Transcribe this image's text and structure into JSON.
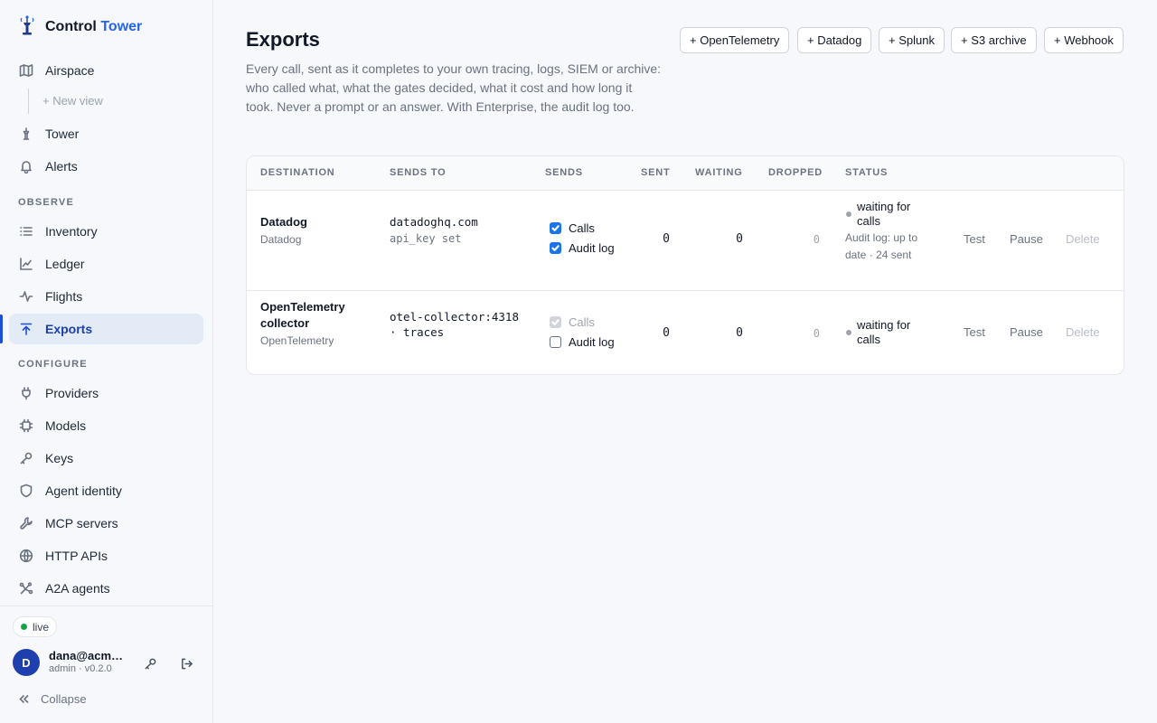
{
  "app": {
    "brand_first": "Control",
    "brand_second": "Tower"
  },
  "sidebar": {
    "airspace": "Airspace",
    "new_view": "+ New view",
    "tower": "Tower",
    "alerts": "Alerts",
    "observe_label": "OBSERVE",
    "inventory": "Inventory",
    "ledger": "Ledger",
    "flights": "Flights",
    "exports": "Exports",
    "configure_label": "CONFIGURE",
    "providers": "Providers",
    "models": "Models",
    "keys": "Keys",
    "agent_identity": "Agent identity",
    "mcp_servers": "MCP servers",
    "http_apis": "HTTP APIs",
    "a2a_agents": "A2A agents",
    "live": "live",
    "avatar_initial": "D",
    "user_name": "dana@acme.com",
    "user_role": "admin · v0.2.0",
    "collapse": "Collapse"
  },
  "page": {
    "title": "Exports",
    "description": "Every call, sent as it completes to your own tracing, logs, SIEM or archive: who called what, what the gates decided, what it cost and how long it took. Never a prompt or an answer. With Enterprise, the audit log too.",
    "add_buttons": [
      "+ OpenTelemetry",
      "+ Datadog",
      "+ Splunk",
      "+ S3 archive",
      "+ Webhook"
    ]
  },
  "table": {
    "headers": {
      "destination": "DESTINATION",
      "sends_to": "SENDS TO",
      "sends": "SENDS",
      "sent": "SENT",
      "waiting": "WAITING",
      "dropped": "DROPPED",
      "status": "STATUS"
    },
    "rows": [
      {
        "name": "Datadog",
        "type": "Datadog",
        "target": "datadoghq.com",
        "target_sub": "api_key set",
        "calls_label": "Calls",
        "calls_checked": true,
        "audit_label": "Audit log",
        "audit_checked": true,
        "sent": "0",
        "waiting": "0",
        "dropped": "0",
        "status": "waiting for calls",
        "status_sub": "Audit log: up to date · 24 sent",
        "test": "Test",
        "pause": "Pause",
        "delete": "Delete"
      },
      {
        "name": "OpenTelemetry collector",
        "type": "OpenTelemetry",
        "target": "otel-collector:4318 · traces",
        "target_sub": "",
        "calls_label": "Calls",
        "calls_checked": true,
        "calls_disabled": true,
        "audit_label": "Audit log",
        "audit_checked": false,
        "sent": "0",
        "waiting": "0",
        "dropped": "0",
        "status": "waiting for calls",
        "status_sub": "",
        "test": "Test",
        "pause": "Pause",
        "delete": "Delete"
      }
    ]
  }
}
